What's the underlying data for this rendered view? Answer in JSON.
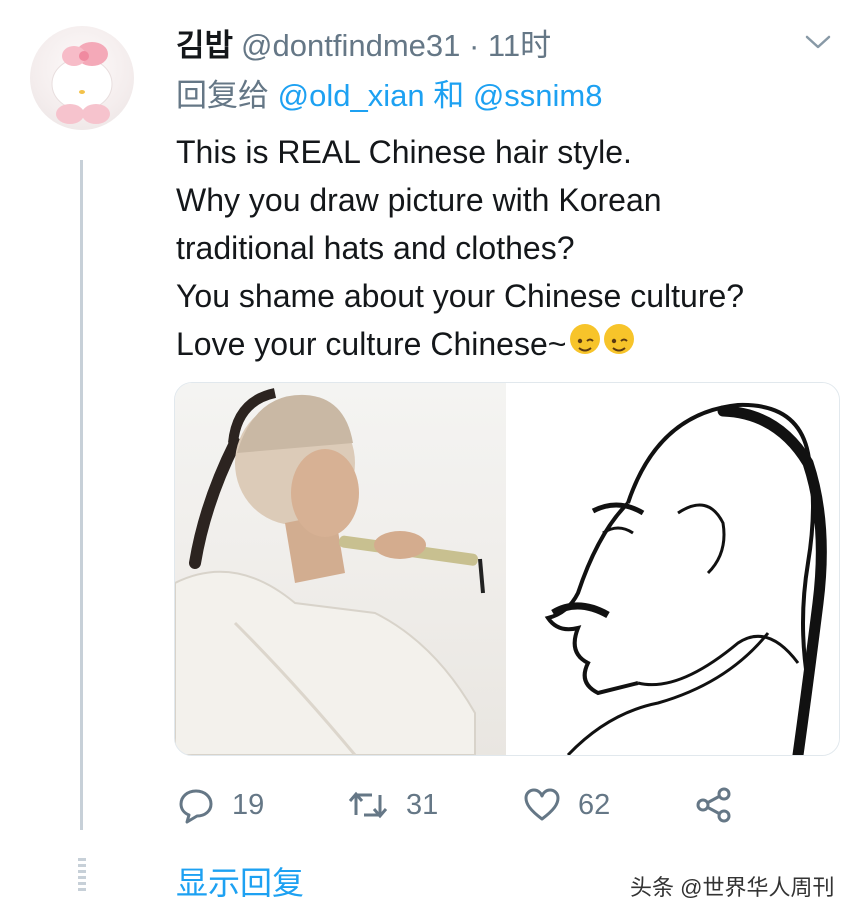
{
  "tweet": {
    "display_name": "김밥",
    "handle": "@dontfindme31 · 11时",
    "replying_prefix": "回复给",
    "reply_to_1": "@old_xian",
    "reply_to_and": "和",
    "reply_to_2": "@ssnim8",
    "text_lines": [
      "This is REAL Chinese hair style.",
      "Why you draw picture with Korean",
      "traditional hats and clothes?",
      "You shame about your Chinese culture?",
      "Love your culture Chinese~"
    ],
    "emojis": [
      "winking-face-icon",
      "winking-face-icon"
    ]
  },
  "actions": {
    "reply_count": "19",
    "retweet_count": "31",
    "like_count": "62"
  },
  "show_replies": "显示回复",
  "watermark": "头条 @世界华人周刊",
  "colors": {
    "link": "#1da1f2",
    "muted": "#657786",
    "text": "#14171a"
  }
}
